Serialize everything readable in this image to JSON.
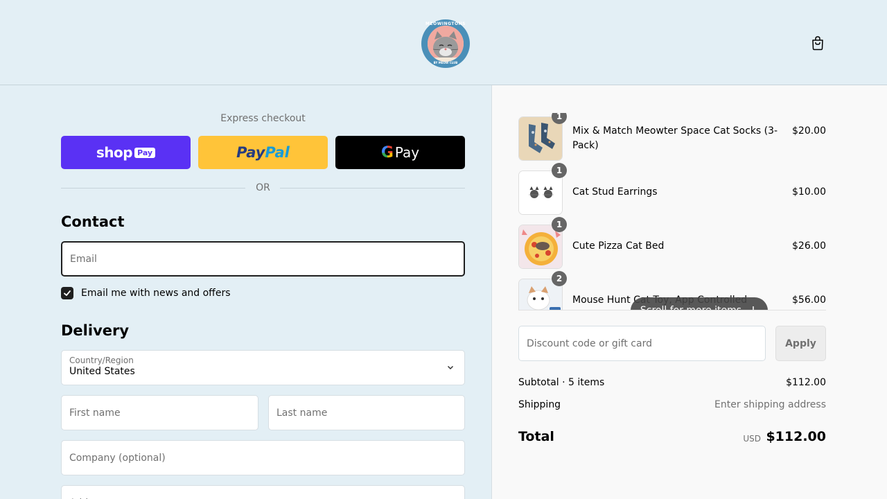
{
  "header": {
    "logo_text_top": "MEOWINGTONS",
    "logo_text_bottom": "BY MEOW CLUB",
    "cart_icon": "shopping-bag-icon"
  },
  "express": {
    "title": "Express checkout",
    "shop_pay": {
      "label": "shop",
      "tag": "Pay"
    },
    "paypal": {
      "label_a": "Pay",
      "label_b": "Pal"
    },
    "gpay": {
      "label_g": "G",
      "label": "Pay"
    },
    "or_text": "OR"
  },
  "contact": {
    "title": "Contact",
    "email_placeholder": "Email",
    "newsletter_label": "Email me with news and offers",
    "newsletter_checked": true
  },
  "delivery": {
    "title": "Delivery",
    "country_label": "Country/Region",
    "country_value": "United States",
    "first_name_placeholder": "First name",
    "last_name_placeholder": "Last name",
    "company_placeholder": "Company (optional)",
    "address_placeholder": "Address"
  },
  "order": {
    "items": [
      {
        "name": "Mix & Match Meowter Space Cat Socks (3-Pack)",
        "price": "$20.00",
        "qty": "1"
      },
      {
        "name": "Cat Stud Earrings",
        "price": "$10.00",
        "qty": "1"
      },
      {
        "name": "Cute Pizza Cat Bed",
        "price": "$26.00",
        "qty": "1"
      },
      {
        "name": "Mouse Hunt Cat Toy, App Controlled",
        "price": "$56.00",
        "qty": "2"
      }
    ],
    "scroll_hint": "Scroll for more items",
    "discount_placeholder": "Discount code or gift card",
    "apply_label": "Apply",
    "subtotal_label": "Subtotal · 5 items",
    "subtotal_value": "$112.00",
    "shipping_label": "Shipping",
    "shipping_value": "Enter shipping address",
    "total_label": "Total",
    "total_currency": "USD",
    "total_value": "$112.00"
  },
  "colors": {
    "background": "#e3eff5",
    "shop_pay": "#5a31f4",
    "paypal": "#ffc439",
    "gpay": "#000000"
  }
}
